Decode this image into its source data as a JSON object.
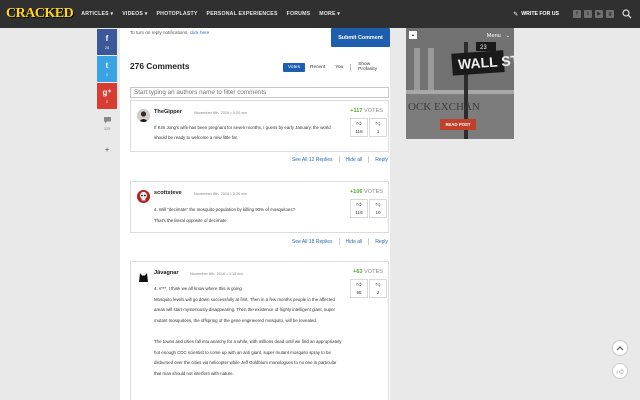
{
  "nav": {
    "logo": "CRACKED",
    "items": [
      "ARTICLES ▾",
      "VIDEOS ▾",
      "PHOTOPLASTY",
      "PERSONAL EXPERIENCES",
      "FORUMS",
      "MORE ▾"
    ],
    "write_label": "WRITE FOR US",
    "social": [
      "f",
      "t",
      "▶",
      "g"
    ]
  },
  "share": {
    "facebook_count": "28",
    "twitter_count": "0",
    "google_count": "0",
    "comments_count": "325"
  },
  "comments_section": {
    "notification_prefix": "To turn on reply notifications, ",
    "notification_link": "click here",
    "submit_label": "Submit Comment",
    "count_label": "276 Comments",
    "sort_tabs": [
      "Votes",
      "Recent",
      "You",
      "Show Profanity"
    ],
    "filter_placeholder": "Start typing an authors name to filter comments"
  },
  "comments": [
    {
      "author": "TheGipper",
      "date": "November 8th, 2016   •   3:20 am",
      "votes_number": "+117",
      "votes_suffix": " VOTES",
      "likes": "116",
      "dislikes": "1",
      "paragraphs": [
        "If Kim Jong's wife has been pregnant for seven months, I guess by early January, the world should be ready to welcome a new little fat."
      ],
      "see_all": "See All 12 Replies",
      "hide": "Hide all",
      "reply": "Reply"
    },
    {
      "author": "scottsteve",
      "date": "November 8th, 2016   •   5:26 am",
      "votes_number": "+106",
      "votes_suffix": " VOTES",
      "likes": "116",
      "dislikes": "10",
      "paragraphs": [
        "4. Will \"decimate\" the mosquito population by killing 90% of mosquitoes?",
        "That's the literal opposite of decimate."
      ],
      "see_all": "See All 18 Replies",
      "hide": "Hide all",
      "reply": "Reply"
    },
    {
      "author": "Jāvagnar",
      "date": "November 8th, 2016   •   4:15 am",
      "votes_number": "+63",
      "votes_suffix": " VOTES",
      "likes": "65",
      "dislikes": "2",
      "paragraphs": [
        "4. s***, I think we all know where this is going.",
        "Mosquito levels will go down successfully at first. Then in a few months people in the affected areas will start mysteriously disappearing. Then the existence of highly intelligent giant, super mutant mosquitoes, the offspring of the gene engineered mosquito, will be revealed.",
        "The towns and cities fall into anarchy for a while, with millions dead until we find an appropriately hot enough CDC scientist to come up with an anti giant, super mutant mosquito spray to be disbursed over the cities via helicopter while Jeff Goldblum monologues to no one in particular that man should not interfere with nature."
      ]
    }
  ],
  "ad": {
    "menu_label": "Menu",
    "read_post": "READ POST",
    "sign_text": "WALL ST",
    "sign_number": "23",
    "building_text": "OCK EXCHAN"
  },
  "colors": {
    "accent": "#1d5fae",
    "vote_positive": "#5aa532",
    "nav_bg": "#303030",
    "logo": "#ffd61f"
  }
}
